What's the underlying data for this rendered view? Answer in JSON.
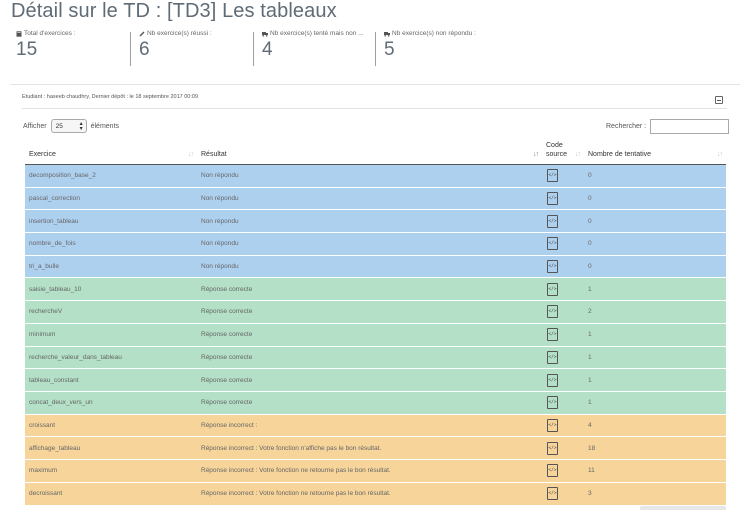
{
  "title": "Détail sur le TD : [TD3] Les tableaux",
  "stats": [
    {
      "label": "Total d'exercices :",
      "value": "15",
      "icon": "book-icon"
    },
    {
      "label": "Nb exercice(s) réussi :",
      "value": "6",
      "icon": "pencil-icon"
    },
    {
      "label": "Nb exercice(s) tenté mais non ...",
      "value": "4",
      "icon": "truck-icon"
    },
    {
      "label": "Nb exercice(s) non répondu :",
      "value": "5",
      "icon": "truck-icon"
    }
  ],
  "panel": {
    "header": "Etudiant : haseeb chaudhry, Dernier dépôt : le 18 septembre 2017 00:09"
  },
  "controls": {
    "show_label": "Afficher",
    "page_length": "25",
    "elements_label": "éléments",
    "search_label": "Rechercher :",
    "search_value": ""
  },
  "columns": [
    "Exercice",
    "Résultat",
    "Code source",
    "Nombre de tentative"
  ],
  "rows": [
    {
      "exercice": "decomposition_base_2",
      "resultat": "Non répondu",
      "tentatives": "0",
      "status": "nonrep"
    },
    {
      "exercice": "pascal_correction",
      "resultat": "Non répondu",
      "tentatives": "0",
      "status": "nonrep"
    },
    {
      "exercice": "insertion_tableau",
      "resultat": "Non répondu",
      "tentatives": "0",
      "status": "nonrep"
    },
    {
      "exercice": "nombre_de_fois",
      "resultat": "Non répondu",
      "tentatives": "0",
      "status": "nonrep"
    },
    {
      "exercice": "tri_a_bulle",
      "resultat": "Non répondu",
      "tentatives": "0",
      "status": "nonrep"
    },
    {
      "exercice": "saisie_tableau_10",
      "resultat": "Réponse correcte",
      "tentatives": "1",
      "status": "correct"
    },
    {
      "exercice": "rechercheV",
      "resultat": "Réponse correcte",
      "tentatives": "2",
      "status": "correct"
    },
    {
      "exercice": "minimum",
      "resultat": "Réponse correcte",
      "tentatives": "1",
      "status": "correct"
    },
    {
      "exercice": "recherche_valeur_dans_tableau",
      "resultat": "Réponse correcte",
      "tentatives": "1",
      "status": "correct"
    },
    {
      "exercice": "tableau_constant",
      "resultat": "Réponse correcte",
      "tentatives": "1",
      "status": "correct"
    },
    {
      "exercice": "concat_deux_vers_un",
      "resultat": "Réponse correcte",
      "tentatives": "1",
      "status": "correct"
    },
    {
      "exercice": "croissant",
      "resultat": "Réponse incorrect :",
      "tentatives": "4",
      "status": "incorrect"
    },
    {
      "exercice": "affichage_tableau",
      "resultat": "Réponse incorrect : Votre fonction n'affiche pas le bon résultat.",
      "tentatives": "18",
      "status": "incorrect"
    },
    {
      "exercice": "maximum",
      "resultat": "Réponse incorrect : Votre fonction ne retourne pas le bon résultat.",
      "tentatives": "11",
      "status": "incorrect"
    },
    {
      "exercice": "decroissant",
      "resultat": "Réponse incorrect : Votre fonction ne retourne pas le bon résultat.",
      "tentatives": "3",
      "status": "incorrect"
    }
  ],
  "colors": {
    "nonrep": "#aed0ef",
    "correct": "#b3e0c6",
    "incorrect": "#f6d49a"
  }
}
